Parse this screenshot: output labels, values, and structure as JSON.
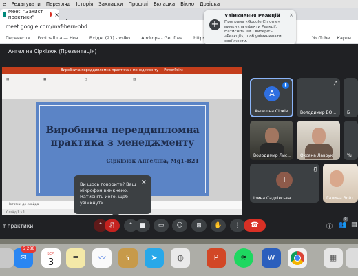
{
  "menubar": {
    "items": [
      "е",
      "Редагувати",
      "Перегляд",
      "Історія",
      "Закладки",
      "Профілі",
      "Вкладка",
      "Вікно",
      "Довідка"
    ]
  },
  "browser": {
    "tab_title": "Meet: \"Захист практики\"",
    "new_tab": "+",
    "url": "meet.google.com/mvf-bern-pbd",
    "bookmarks": [
      "Перевести",
      "Football.ua — Нов...",
      "Вхідні (21) - vsiko...",
      "Airdrops - Get free...",
      "https://www.youtu...",
      "YouTube",
      "Карти"
    ]
  },
  "notification": {
    "title": "Увімкнення Реакцій",
    "body": "Програма «Google Chrome» вимкнула ефекти Реакції. Натисніть ⌨ і виберіть «Реакції», щоб увімк­нювати свої жести.",
    "close": "×"
  },
  "meet": {
    "presenter_label": "Ангеліна Сіркізюк (Презентація)",
    "meeting_title": "т практики",
    "slide": {
      "title": "Виробнича переддипломна практика з менеджменту",
      "subtitle": "Сіркізюк Ангеліна, Mg1-B21"
    },
    "ppt": {
      "window_title": "Виробнича переддипломна практика з менеджменту — PowerPoint",
      "notes": "Нотатки до слайда",
      "status": "Слайд 1 з 1"
    },
    "tooltip": {
      "text": "Ви щось говорите? Ваш мікрофон вимкнено. Натисніть його, щоб увімкнути.",
      "close": "×"
    },
    "participants": [
      {
        "name": "Ангеліна Сіркіз...",
        "initial": "А",
        "avatar_color": "#2f6fe0",
        "muted": false
      },
      {
        "name": "Володимир БО...",
        "initial": "",
        "avatar_color": "#3c4043",
        "muted": true
      },
      {
        "name": "Б",
        "initial": "",
        "avatar_color": "#3c4043",
        "muted": true
      },
      {
        "name": "Володимир Лис...",
        "initial": "",
        "avatar_color": "#5a5a52",
        "muted": false
      },
      {
        "name": "Оксана Лаврук",
        "initial": "",
        "avatar_color": "#cfc6b8",
        "muted": false
      },
      {
        "name": "Yu",
        "initial": "",
        "avatar_color": "#3c4043",
        "muted": false
      },
      {
        "name": "Ірина Садлівська",
        "initial": "І",
        "avatar_color": "#8d5a4a",
        "muted": true
      },
      {
        "name": "Галина Войт...",
        "initial": "",
        "avatar_color": "#d8c7b5",
        "muted": false
      }
    ],
    "controls": {
      "hangup": "☎",
      "badge_count": "9"
    }
  },
  "dock": {
    "mail_badge": "5 288",
    "calendar_month": "БЕР.",
    "calendar_day": "3"
  }
}
